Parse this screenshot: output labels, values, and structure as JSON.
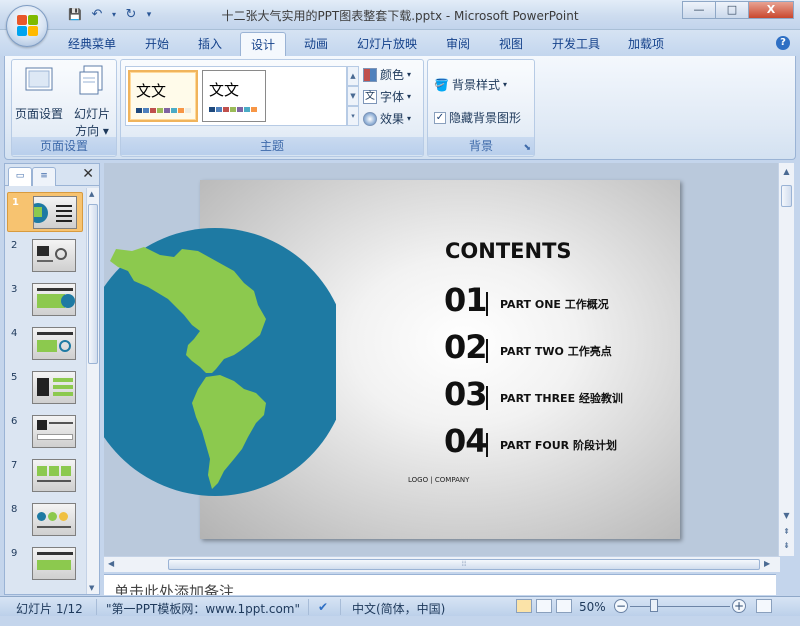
{
  "window": {
    "title": "十二张大气实用的PPT图表整套下载.pptx - Microsoft PowerPoint",
    "min": "—",
    "max": "□",
    "close": "X"
  },
  "qat": {
    "save": "💾",
    "undo": "↶",
    "redo": "↻",
    "more": "▾"
  },
  "tabs": [
    "经典菜单",
    "开始",
    "插入",
    "设计",
    "动画",
    "幻灯片放映",
    "审阅",
    "视图",
    "开发工具",
    "加载项"
  ],
  "active_tab": "设计",
  "ribbon": {
    "page_setup": {
      "group_label": "页面设置",
      "page_setup_btn": "页面设置",
      "orientation_btn": "幻灯片",
      "orientation_btn2": "方向 ▾"
    },
    "themes": {
      "group_label": "主题",
      "theme1_text": "文文",
      "theme2_text": "文文",
      "colors": "颜色",
      "fonts": "字体",
      "effects": "效果"
    },
    "background": {
      "group_label": "背景",
      "bg_styles": "背景样式",
      "hide_bg": "隐藏背景图形",
      "hide_bg_checked": true
    }
  },
  "slides_pane": {
    "thumbnails": [
      "1",
      "2",
      "3",
      "4",
      "5",
      "6",
      "7",
      "8",
      "9"
    ],
    "selected": 1
  },
  "slide": {
    "heading": "CONTENTS",
    "items": [
      {
        "num": "01",
        "label": "PART ONE  工作概况"
      },
      {
        "num": "02",
        "label": "PART TWO  工作亮点"
      },
      {
        "num": "03",
        "label": "PART THREE  经验教训"
      },
      {
        "num": "04",
        "label": "PART FOUR  阶段计划"
      }
    ],
    "logo_text": "LOGO | COMPANY",
    "globe_ocean_color": "#1e7aa3",
    "globe_land_color": "#8cc94e"
  },
  "notes_placeholder": "单击此处添加备注",
  "status": {
    "slide_info": "幻灯片 1/12",
    "theme_name": "\"第一PPT模板网：www.1ppt.com\"",
    "language": "中文(简体，中国)",
    "zoom": "50%"
  }
}
